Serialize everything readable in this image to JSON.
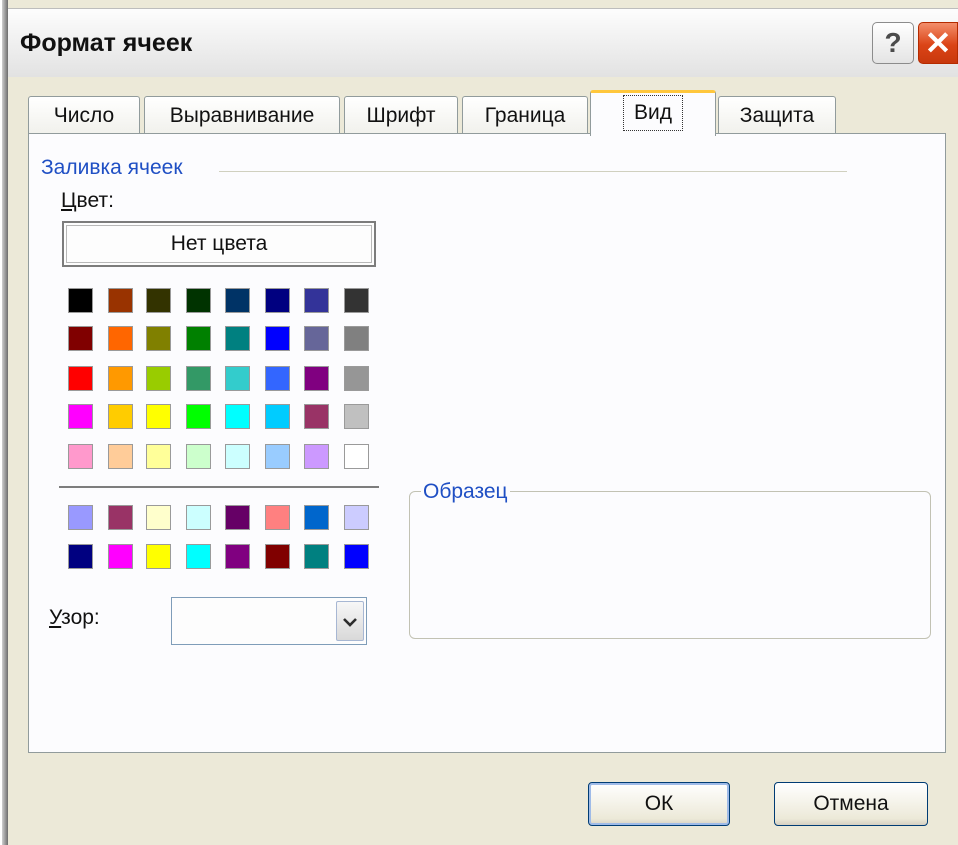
{
  "window": {
    "title": "Формат ячеек",
    "help_glyph": "?",
    "close_glyph": "✕"
  },
  "tabs": [
    {
      "label": "Число",
      "active": false
    },
    {
      "label": "Выравнивание",
      "active": false
    },
    {
      "label": "Шрифт",
      "active": false
    },
    {
      "label": "Граница",
      "active": false
    },
    {
      "label": "Вид",
      "active": true
    },
    {
      "label": "Защита",
      "active": false
    }
  ],
  "fill": {
    "group_label": "Заливка ячеек",
    "color_label_first": "Ц",
    "color_label_rest": "вет:",
    "no_color_label": "Нет цвета",
    "palette_main": [
      [
        "#000000",
        "#993300",
        "#333300",
        "#003300",
        "#003366",
        "#000080",
        "#333399",
        "#333333"
      ],
      [
        "#800000",
        "#ff6600",
        "#808000",
        "#008000",
        "#008080",
        "#0000ff",
        "#666699",
        "#808080"
      ],
      [
        "#ff0000",
        "#ff9900",
        "#99cc00",
        "#339966",
        "#33cccc",
        "#3366ff",
        "#800080",
        "#969696"
      ],
      [
        "#ff00ff",
        "#ffcc00",
        "#ffff00",
        "#00ff00",
        "#00ffff",
        "#00ccff",
        "#993366",
        "#c0c0c0"
      ],
      [
        "#ff99cc",
        "#ffcc99",
        "#ffff99",
        "#ccffcc",
        "#ccffff",
        "#99ccff",
        "#cc99ff",
        "#ffffff"
      ]
    ],
    "palette_extra": [
      [
        "#9999ff",
        "#993366",
        "#ffffcc",
        "#ccffff",
        "#660066",
        "#ff8080",
        "#0066cc",
        "#ccccff"
      ],
      [
        "#000080",
        "#ff00ff",
        "#ffff00",
        "#00ffff",
        "#800080",
        "#800000",
        "#008080",
        "#0000ff"
      ]
    ],
    "pattern_label_first": "У",
    "pattern_label_rest": "зор:",
    "pattern_value": "",
    "dropdown_icon": "chevron-down-icon"
  },
  "sample": {
    "label": "Образец"
  },
  "buttons": {
    "ok": "ОК",
    "cancel": "Отмена"
  }
}
